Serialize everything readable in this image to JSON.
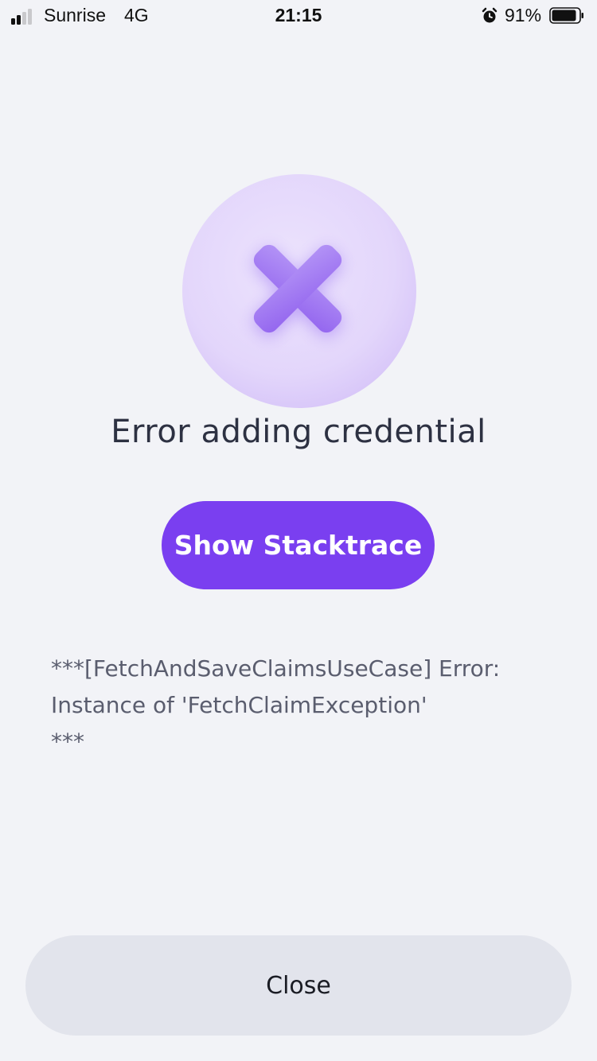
{
  "status_bar": {
    "carrier": "Sunrise",
    "network": "4G",
    "time": "21:15",
    "battery_percent": "91%",
    "alarm_icon": "alarm-clock-icon",
    "battery_level": 0.91
  },
  "error_icon": "error-x-icon",
  "title": "Error adding credential",
  "show_stacktrace_label": "Show Stacktrace",
  "error_message": "***[FetchAndSaveClaimsUseCase] Error: Instance of 'FetchClaimException'\n***",
  "close_label": "Close",
  "colors": {
    "background": "#f2f3f7",
    "accent": "#7a3ff0",
    "icon_circle": "#e2d6fb",
    "icon_cross": "#a27cf2",
    "close_button_bg": "#e2e4ec",
    "title_text": "#2d3142"
  }
}
